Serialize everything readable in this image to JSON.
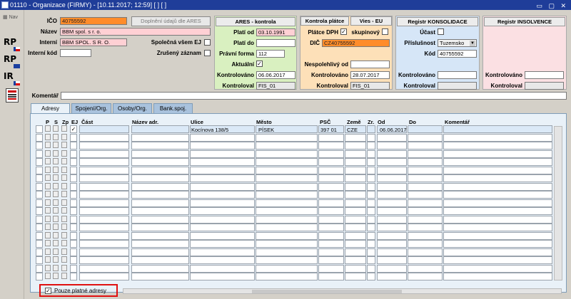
{
  "window": {
    "title": "01110 - Organizace (FIRMY) - [10.11.2017; 12:59]  [ ]  [ ]",
    "controls": "▭ ▢ ✕"
  },
  "side": {
    "nav": "Nav",
    "icons": [
      "RP",
      "RP",
      "IR",
      ""
    ]
  },
  "form": {
    "ico_label": "IČO",
    "ico": "40755592",
    "ares_button": "Doplnění údajů dle ARES",
    "nazev_label": "Název",
    "nazev": "BBM spol. s r. o.",
    "interni_label": "Interní",
    "interni": "BBM SPOL. S R. O.",
    "spolecna_label": "Společná všem EJ",
    "interni_kod_label": "Interní kód",
    "zruseny_label": "Zrušený záznam",
    "komentar_label": "Komentář"
  },
  "ares": {
    "title": "ARES - kontrola",
    "plati_od_label": "Platí od",
    "plati_od": "03.10.1991",
    "plati_do_label": "Platí do",
    "pravni_forma_label": "Právní forma",
    "pravni_forma": "112",
    "aktualni_label": "Aktuální",
    "kontrolovano_label": "Kontrolováno",
    "kontrolovano": "06.06.2017",
    "kontroloval_label": "Kontroloval",
    "kontroloval": "FIS_01"
  },
  "platce": {
    "title": "Kontrola plátce",
    "vies_title": "Vies - EU",
    "platce_dph_label": "Plátce DPH",
    "skupinovy_label": "skupinový",
    "dic_label": "DIČ",
    "dic": "CZ40755592",
    "nespolehlivy_label": "Nespolehlivý od",
    "kontrolovano_label": "Kontrolováno",
    "kontrolovano": "28.07.2017",
    "kontroloval_label": "Kontroloval",
    "kontroloval": "FIS_01"
  },
  "konsolidace": {
    "title": "Registr KONSOLIDACE",
    "ucast_label": "Účast",
    "prislusnost_label": "Příslušnost",
    "prislusnost": "Tuzemsko",
    "kod_label": "Kód",
    "kod": "40755592",
    "kontrolovano_label": "Kontrolováno",
    "kontroloval_label": "Kontroloval"
  },
  "insolvence": {
    "title": "Registr INSOLVENCE",
    "kontrolovano_label": "Kontrolováno",
    "kontroloval_label": "Kontroloval"
  },
  "tabs": [
    "Adresy",
    "Spojení/Org.",
    "Osoby/Org.",
    "Bank.spoj."
  ],
  "table": {
    "headers": {
      "p": "P",
      "s": "S",
      "zp": "Zp",
      "ej": "EJ",
      "cast": "Část",
      "nazev": "Název adr.",
      "ulice": "Ulice",
      "mesto": "Město",
      "psc": "PSČ",
      "zeme": "Země",
      "zr": "Zr.",
      "od": "Od",
      "do": "Do",
      "komentar": "Komentář"
    },
    "row1": {
      "ulice": "Kocínova 138/5",
      "mesto": "PÍSEK",
      "psc": "397 01",
      "zeme": "CZE",
      "od": "06.06.2017"
    }
  },
  "footer": {
    "pouze_label": "Pouze platné adresy"
  }
}
